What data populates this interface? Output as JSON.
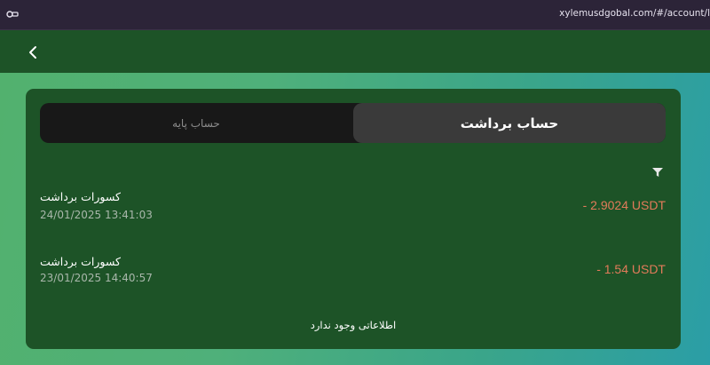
{
  "browser": {
    "url": "xylemusdgobal.com/#/account/l"
  },
  "appbar": {
    "back_icon": "chevron-left-icon"
  },
  "tabs": [
    {
      "label": "حساب پایه",
      "active": false
    },
    {
      "label": "حساب برداشت",
      "active": true
    }
  ],
  "filter": {
    "icon": "funnel-icon"
  },
  "transactions": [
    {
      "title": "کسورات برداشت",
      "date": "24/01/2025 13:41:03",
      "amount": "- 2.9024 USDT"
    },
    {
      "title": "کسورات برداشت",
      "date": "23/01/2025 14:40:57",
      "amount": "- 1.54 USDT"
    }
  ],
  "empty_message": "اطلاعاتی وجود ندارد",
  "colors": {
    "appbar": "#1d5327",
    "card": "#1d5327",
    "amount": "#e27b5a",
    "tab_active_bg": "#3a3a3a",
    "tab_bar_bg": "#181818"
  }
}
